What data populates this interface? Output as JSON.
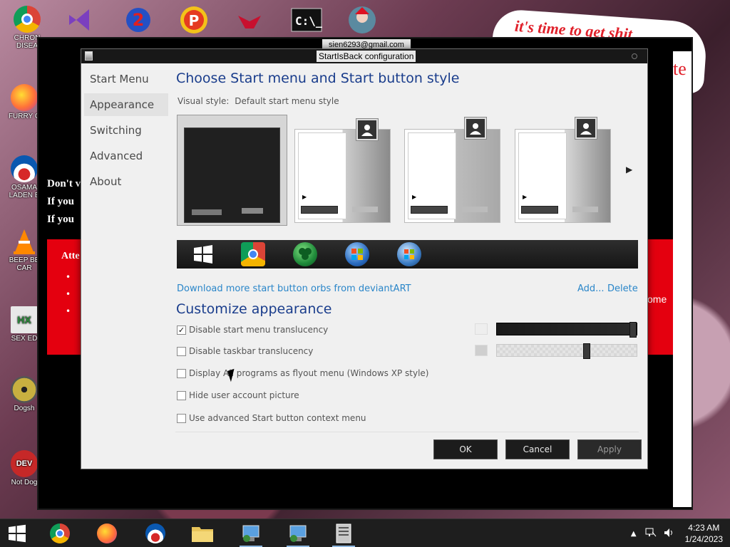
{
  "desktop": {
    "left_icons": [
      {
        "label": "CHRON\nDISEA",
        "color": "#db4437",
        "glyph": "●"
      },
      {
        "label": "FURRY C",
        "color": "#ff7139",
        "glyph": "●"
      },
      {
        "label": "OSAMA\nLADEN E",
        "color": "#0a58b0",
        "glyph": "●"
      },
      {
        "label": "BEEP BE\nCAR",
        "color": "#ff8800",
        "glyph": "▲"
      },
      {
        "label": "SEX ED",
        "color": "#e0e0e0",
        "glyph": "HX"
      },
      {
        "label": "Dogsh",
        "color": "#8a7a2a",
        "glyph": "●"
      },
      {
        "label": "Not Dog",
        "color": "#c62828",
        "glyph": "DEV"
      }
    ],
    "graffiti_text": "it's time to get shit",
    "graffiti_right": "te"
  },
  "outer_window": {
    "email": "sien6293@gmail.com",
    "ghost_lines": [
      "Don't v",
      "If you",
      "If you"
    ],
    "red_block_text": "Atte",
    "red_block_right_text": "ome"
  },
  "dialog": {
    "title": "StartIsBack configuration",
    "nav": [
      "Start Menu",
      "Appearance",
      "Switching",
      "Advanced",
      "About"
    ],
    "heading_style": "Choose Start menu and Start button style",
    "visual_style_label": "Visual style:",
    "visual_style_value": "Default start menu style",
    "download_link": "Download more start button orbs from deviantART",
    "add_link": "Add...",
    "delete_link": "Delete",
    "heading_customize": "Customize appearance",
    "options": [
      {
        "label": "Disable start menu translucency",
        "checked": true
      },
      {
        "label": "Disable taskbar translucency",
        "checked": false
      },
      {
        "label": "Display All programs as flyout menu (Windows XP style)",
        "checked": false
      },
      {
        "label": "Hide user account picture",
        "checked": false
      },
      {
        "label": "Use advanced Start button context menu",
        "checked": false
      }
    ],
    "sliders": [
      {
        "fraction": 1.0
      },
      {
        "fraction": 0.65
      }
    ],
    "buttons": {
      "ok": "OK",
      "cancel": "Cancel",
      "apply": "Apply"
    }
  },
  "taskbar": {
    "time": "4:23 AM",
    "date": "1/24/2023"
  },
  "colors": {
    "heading": "#1a3d8c",
    "link": "#2a86c9",
    "accent_red": "#e4000f"
  }
}
